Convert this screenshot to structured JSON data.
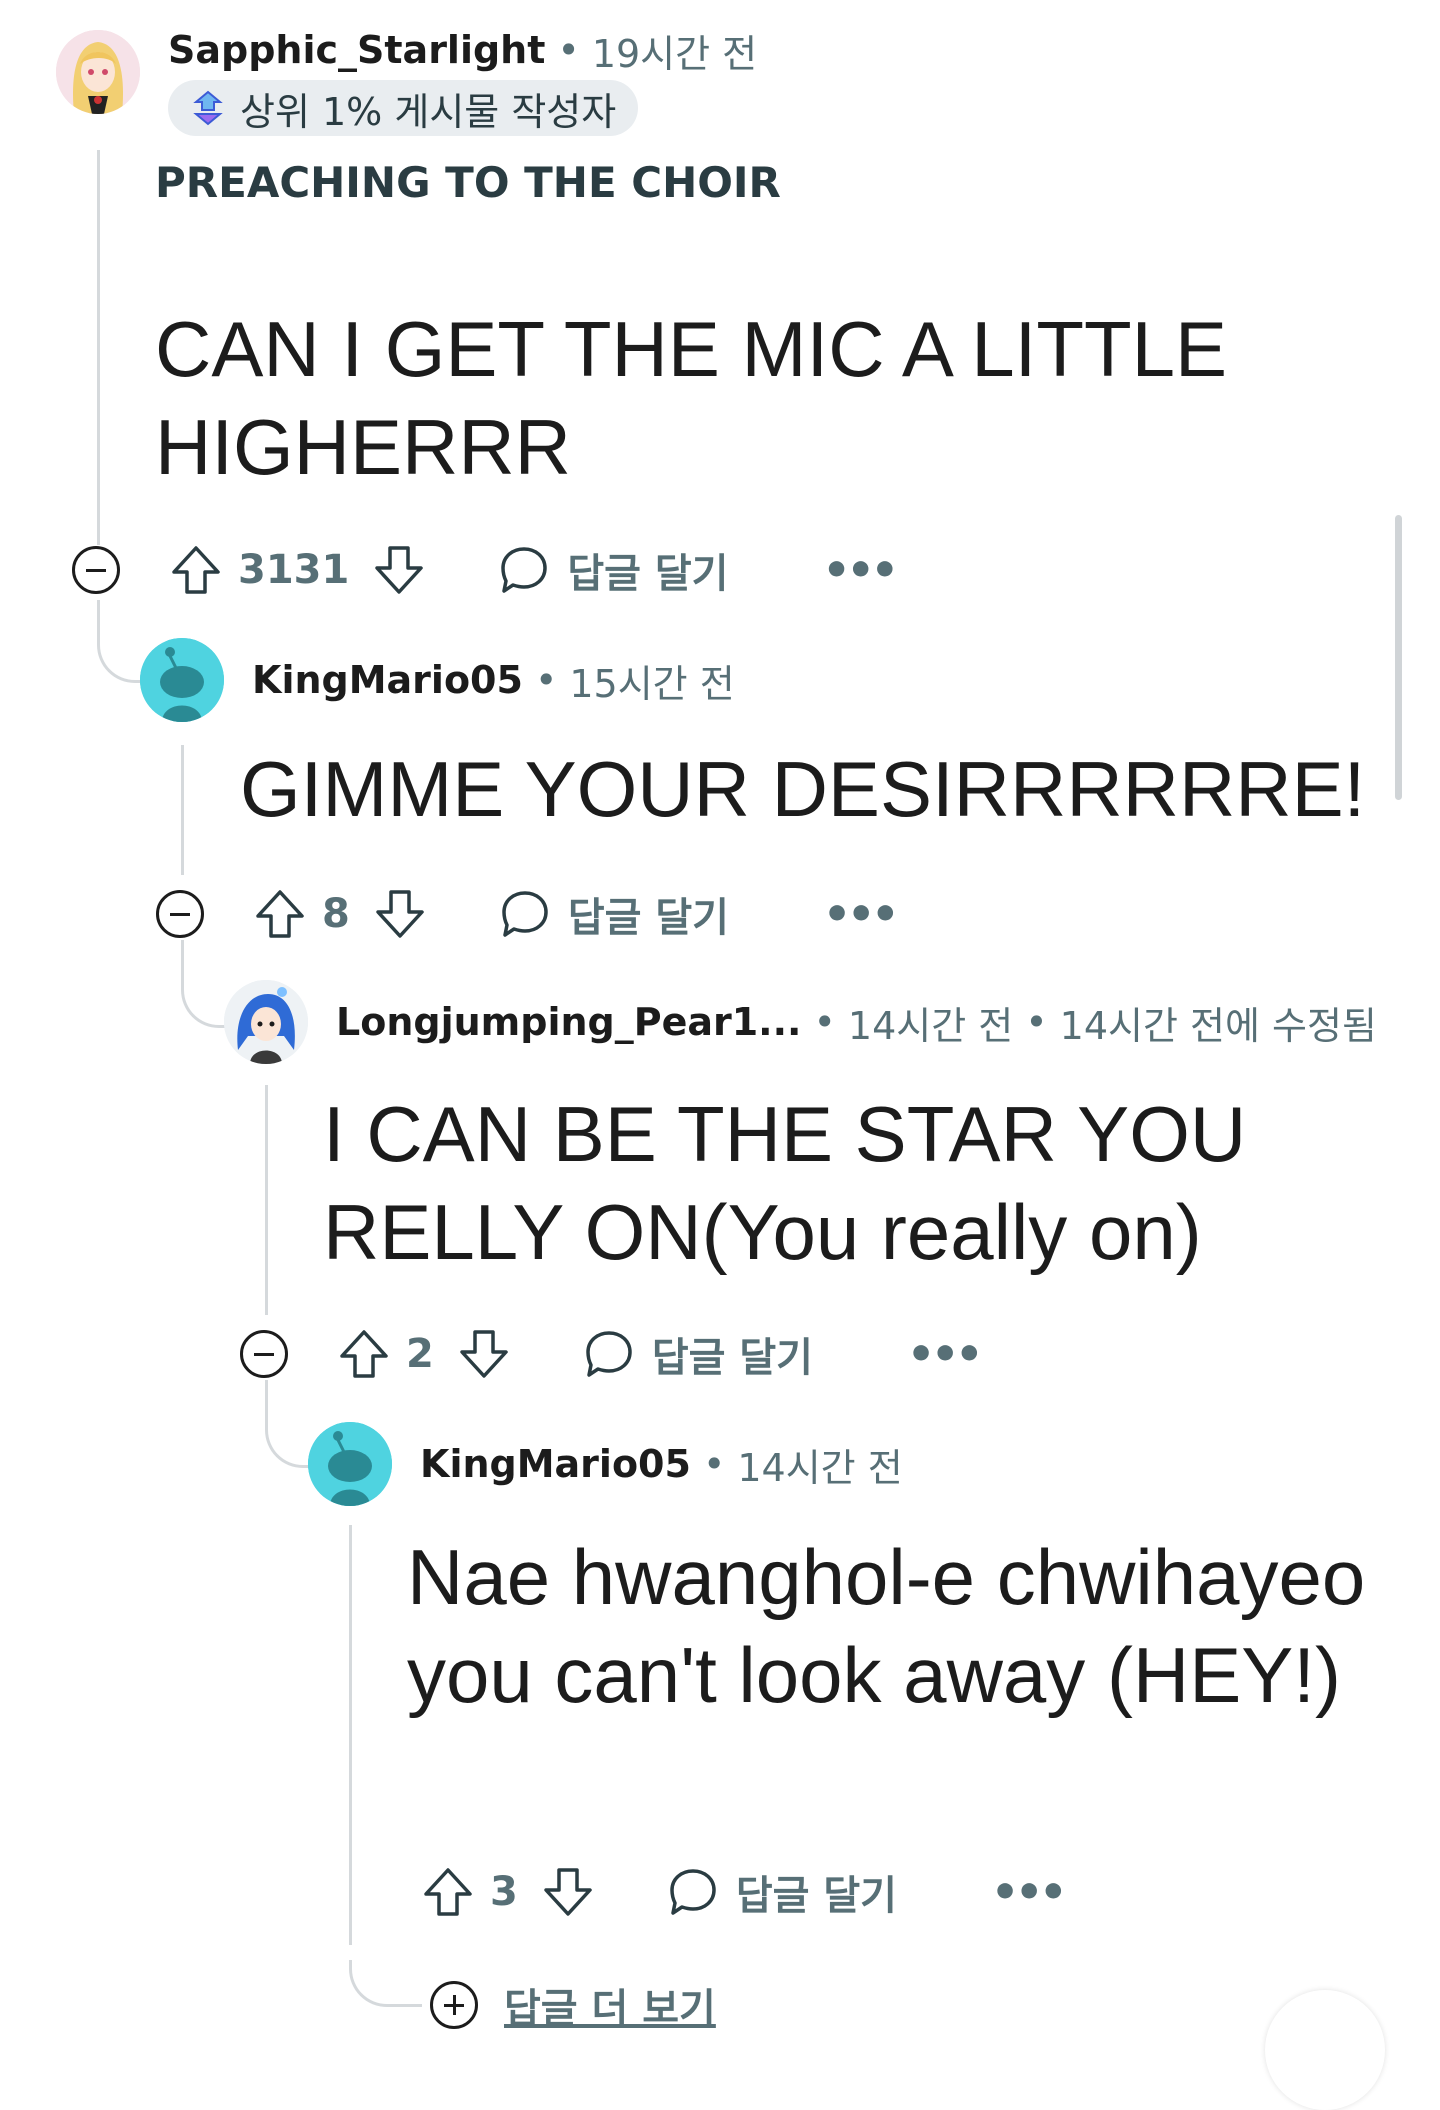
{
  "comments": [
    {
      "username": "Sapphic_Starlight",
      "time": "19시간 전",
      "badge": "상위 1% 게시물 작성자",
      "heading": "PREACHING TO THE CHOIR",
      "body": "CAN I GET THE MIC A LITTLE HIGHERRR",
      "votes": "3131",
      "reply_label": "답글 달기",
      "more": "•••",
      "avatar_icon": "anime-girl-avatar-icon"
    },
    {
      "username": "KingMario05",
      "time": "15시간 전",
      "body": "GIMME YOUR DESIRRRRRRE!",
      "votes": "8",
      "reply_label": "답글 달기",
      "more": "•••",
      "avatar_icon": "snoo-avatar-icon"
    },
    {
      "username": "Longjumping_Pear1...",
      "time": "14시간 전",
      "edited": "14시간 전에 수정됨",
      "body": "I CAN BE THE STAR YOU RELLY ON(You really on)",
      "votes": "2",
      "reply_label": "답글 달기",
      "more": "•••",
      "avatar_icon": "blue-hair-avatar-icon"
    },
    {
      "username": "KingMario05",
      "time": "14시간 전",
      "body": "Nae hwanghol-e chwihayeo you can't look away (HEY!)",
      "votes": "3",
      "reply_label": "답글 달기",
      "more": "•••",
      "avatar_icon": "snoo-avatar-icon"
    }
  ],
  "more_replies": "답글 더 보기",
  "separator": "•",
  "colors": {
    "meta": "#576f76",
    "thread_line": "#d5d9dc",
    "snoo_bg": "#4fd3e0",
    "text": "#1c1c1c"
  }
}
